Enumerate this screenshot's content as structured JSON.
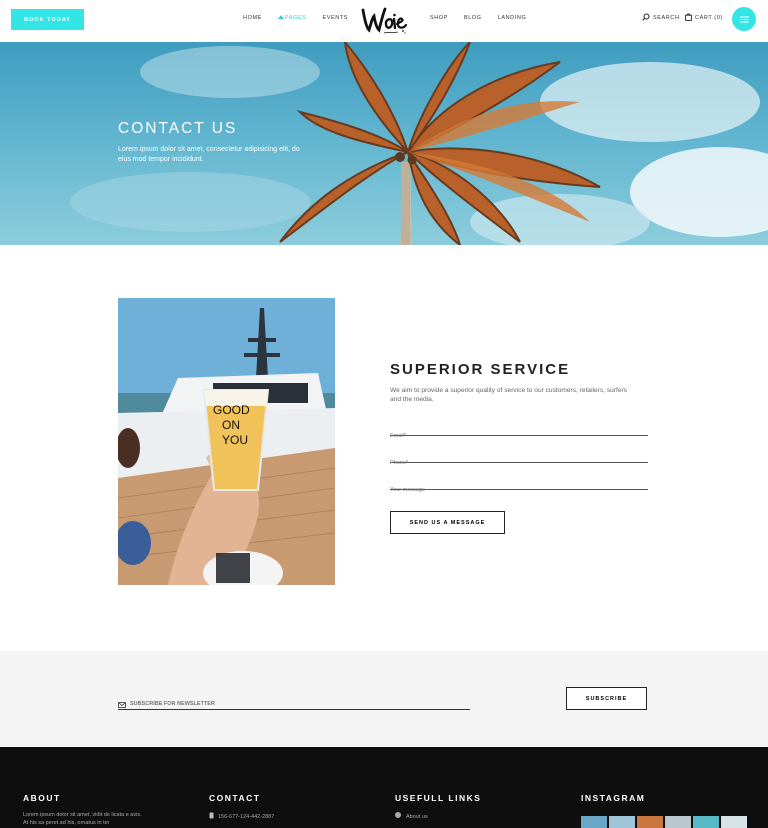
{
  "header": {
    "book_button": "Book Today",
    "nav_left": [
      "Home",
      "Pages",
      "Events"
    ],
    "nav_right": [
      "Shop",
      "Blog",
      "Landing"
    ],
    "logo_text": "Waie",
    "search": "Search",
    "cart": "Cart (0)"
  },
  "hero": {
    "title": "CONTACT US",
    "subtitle": "Lorem ipsum dolor sit amet, consectetur adipisicing elit, do eius mod tempor incididunt."
  },
  "photo": {
    "cup_text": [
      "GOOD",
      "ON",
      "YOU"
    ]
  },
  "service": {
    "title": "SUPERIOR SERVICE",
    "description": "We aim to provide a superior quality of service to our customers, retailers, surfers and the media.",
    "email_placeholder": "Email*",
    "phone_placeholder": "Phone*",
    "message_placeholder": "Your message",
    "send_button": "Send us a message"
  },
  "newsletter": {
    "placeholder": "SUBSCRIBE FOR NEWSLETTER",
    "button": "Subscribe"
  },
  "footer": {
    "about_title": "ABOUT",
    "about_text": "Lorem ipsum dolor sit amet, vidit de licata e avis. At his sa peret ad his, ornatus in ter",
    "contact_title": "CONTACT",
    "contact_phone": "156-677-124-442-2887",
    "links_title": "USEFULL LINKS",
    "links_first": "About us",
    "instagram_title": "INSTAGRAM"
  },
  "colors": {
    "accent": "#33e6e6",
    "footer_bg": "#0e0e0e",
    "newsletter_bg": "#f4f4f4"
  }
}
